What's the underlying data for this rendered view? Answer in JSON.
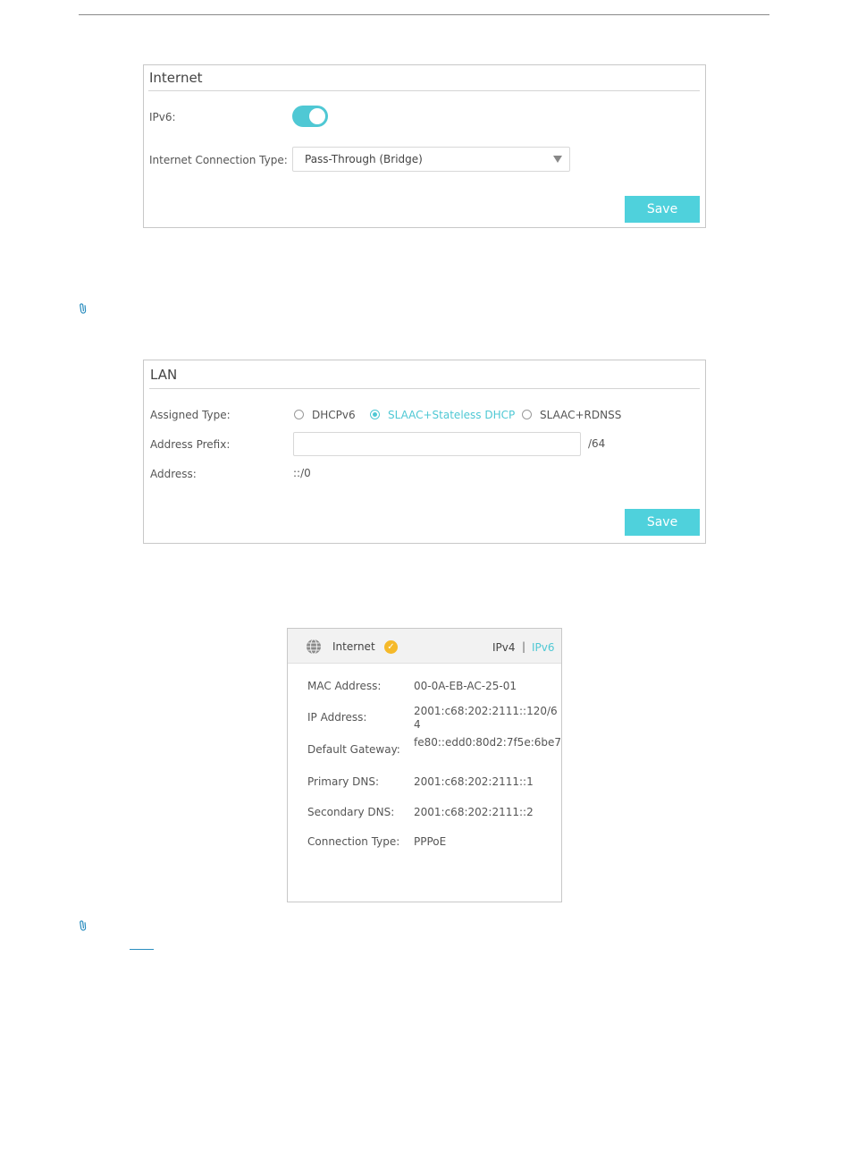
{
  "internet": {
    "title": "Internet",
    "ipv6_label": "IPv6:",
    "ipv6_enabled": true,
    "connection_type_label": "Internet Connection Type:",
    "connection_type_value": "Pass-Through (Bridge)",
    "save_label": "Save"
  },
  "lan": {
    "title": "LAN",
    "assigned_type_label": "Assigned Type:",
    "options": [
      "DHCPv6",
      "SLAAC+Stateless DHCP",
      "SLAAC+RDNSS"
    ],
    "selected_option": "SLAAC+Stateless DHCP",
    "address_prefix_label": "Address Prefix:",
    "address_prefix_value": "",
    "prefix_suffix": "/64",
    "address_label": "Address:",
    "address_value": "::/0",
    "save_label": "Save"
  },
  "status": {
    "title": "Internet",
    "tab_ipv4": "IPv4",
    "tab_separator": "|",
    "tab_ipv6": "IPv6",
    "active_tab": "IPv6",
    "rows": [
      {
        "label": "MAC Address:",
        "value": "00-0A-EB-AC-25-01"
      },
      {
        "label": "IP Address:",
        "value": "2001:c68:202:2111::120/64"
      },
      {
        "label": "Default Gateway:",
        "value": "fe80::edd0:80d2:7f5e:6be7"
      },
      {
        "label": "Primary DNS:",
        "value": "2001:c68:202:2111::1"
      },
      {
        "label": "Secondary DNS:",
        "value": "2001:c68:202:2111::2"
      },
      {
        "label": "Connection Type:",
        "value": "PPPoE"
      }
    ]
  },
  "colors": {
    "accent": "#4fd1dc",
    "badge": "#f5b92a",
    "link": "#2a8dbf"
  },
  "icons": {
    "note": "paperclip-icon",
    "globe": "globe-icon",
    "status_ok": "check-circle-icon"
  }
}
